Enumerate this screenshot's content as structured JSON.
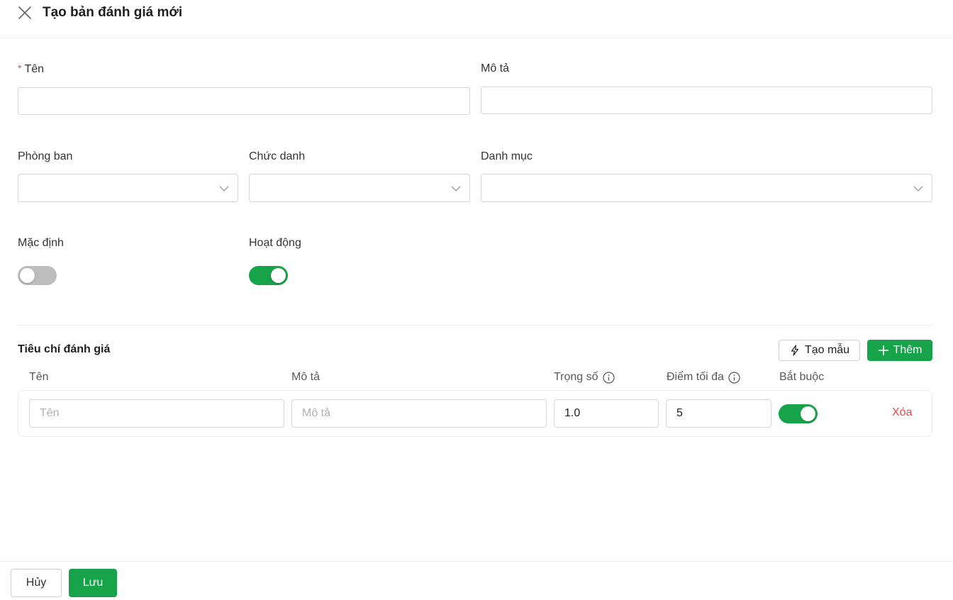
{
  "header": {
    "title": "Tạo bản đánh giá mới",
    "close_icon": "close-icon"
  },
  "form": {
    "name": {
      "label": "Tên",
      "required_mark": "*",
      "value": ""
    },
    "description": {
      "label": "Mô tả",
      "value": ""
    },
    "department": {
      "label": "Phòng ban",
      "value": ""
    },
    "job_title": {
      "label": "Chức danh",
      "value": ""
    },
    "category": {
      "label": "Danh mục",
      "value": ""
    },
    "default_toggle": {
      "label": "Mặc định",
      "checked": false
    },
    "active_toggle": {
      "label": "Hoạt động",
      "checked": true
    }
  },
  "criteria": {
    "section_title": "Tiêu chí đánh giá",
    "template_button": "Tạo mẫu",
    "add_button": "Thêm",
    "columns": {
      "name": "Tên",
      "description": "Mô tả",
      "weight": "Trọng số",
      "max_score": "Điểm tối đa",
      "required": "Bắt buộc"
    },
    "rows": [
      {
        "name_placeholder": "Tên",
        "name": "",
        "description_placeholder": "Mô tả",
        "description": "",
        "weight": "1.0",
        "max_score": "5",
        "required": true,
        "delete_label": "Xóa"
      }
    ]
  },
  "footer": {
    "cancel_label": "Hủy",
    "save_label": "Lưu"
  },
  "colors": {
    "accent_green": "#16a34a",
    "danger_red": "#e5484d",
    "border": "#d6d6d6"
  }
}
